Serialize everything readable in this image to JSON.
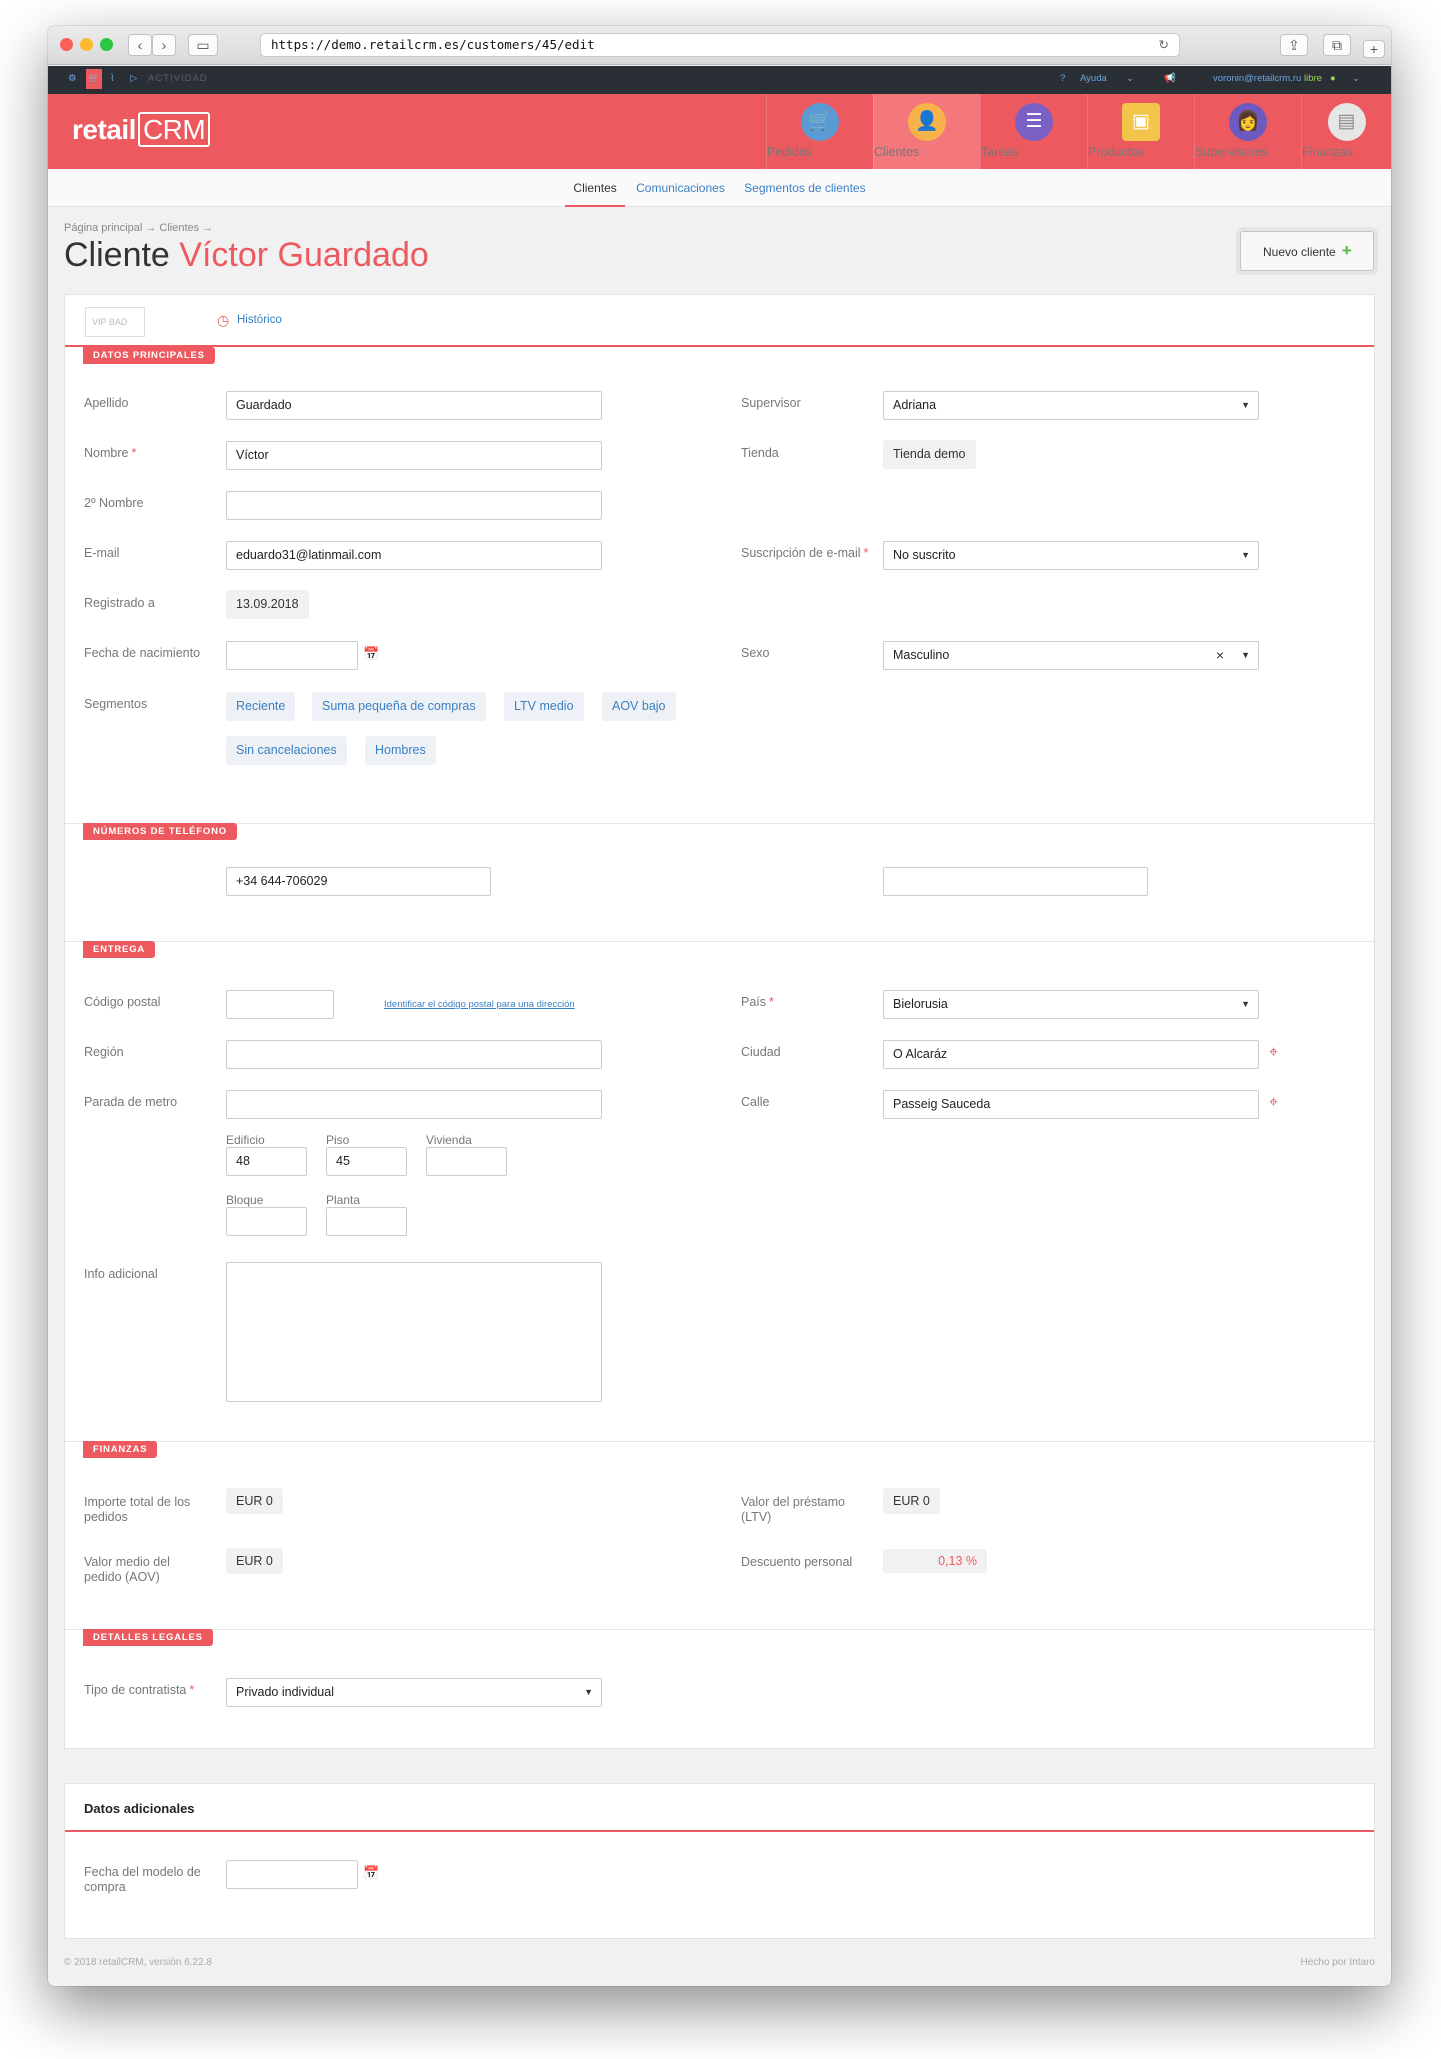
{
  "browser": {
    "url": "https://demo.retailcrm.es/customers/45/edit"
  },
  "topbar": {
    "activity": "ACTIVIDAD",
    "help": "Ayuda",
    "user": "voronin@retailcrm.ru",
    "status": "libre"
  },
  "brand": {
    "logo_left": "retail",
    "logo_right": "CRM"
  },
  "nav": [
    {
      "label": "Pedidos",
      "icon": "cart-icon"
    },
    {
      "label": "Clientes",
      "icon": "customer-icon"
    },
    {
      "label": "Tareas",
      "icon": "tasks-icon"
    },
    {
      "label": "Productos",
      "icon": "box-icon"
    },
    {
      "label": "Supervisores",
      "icon": "manager-icon"
    },
    {
      "label": "Finanzas",
      "icon": "finance-icon"
    }
  ],
  "subnav": [
    "Clientes",
    "Comunicaciones",
    "Segmentos de clientes"
  ],
  "breadcrumb": "Página principal → Clientes →",
  "page": {
    "title_prefix": "Cliente",
    "customer_name": "Víctor Guardado",
    "new_button": "Nuevo cliente"
  },
  "markers": {
    "vip": "VIP",
    "bad": "BAD",
    "history": "Histórico"
  },
  "main": {
    "section": "DATOS PRINCIPALES",
    "apellido_label": "Apellido",
    "apellido": "Guardado",
    "nombre_label": "Nombre",
    "nombre": "Víctor",
    "nombre2_label": "2º Nombre",
    "nombre2": "",
    "email_label": "E-mail",
    "email": "eduardo31@latinmail.com",
    "registered_label": "Registrado a",
    "registered": "13.09.2018",
    "birth_label": "Fecha de nacimiento",
    "birth": "",
    "segments_label": "Segmentos",
    "segments": [
      "Reciente",
      "Suma pequeña de compras",
      "LTV medio",
      "AOV bajo",
      "Sin cancelaciones",
      "Hombres"
    ],
    "supervisor_label": "Supervisor",
    "supervisor": "Adriana",
    "store_label": "Tienda",
    "store": "Tienda demo",
    "subscription_label": "Suscripción de e-mail",
    "subscription": "No suscrito",
    "sex_label": "Sexo",
    "sex": "Masculino"
  },
  "phones": {
    "section": "NÚMEROS DE TELÉFONO",
    "phone1": "+34 644-706029",
    "phone2": ""
  },
  "delivery": {
    "section": "ENTREGA",
    "zip_label": "Código postal",
    "zip": "",
    "zip_link": "Identificar el código postal para una dirección",
    "region_label": "Región",
    "region": "",
    "metro_label": "Parada de metro",
    "metro": "",
    "building_label": "Edificio",
    "building": "48",
    "floor_label": "Piso",
    "floor": "45",
    "flat_label": "Vivienda",
    "flat": "",
    "block_label": "Bloque",
    "block": "",
    "storey_label": "Planta",
    "storey": "",
    "info_label": "Info adicional",
    "info": "",
    "country_label": "País",
    "country": "Bielorusia",
    "city_label": "Ciudad",
    "city": "O Alcaráz",
    "street_label": "Calle",
    "street": "Passeig Sauceda"
  },
  "finance": {
    "section": "FINANZAS",
    "total_label": "Importe total de los pedidos",
    "total": "EUR 0",
    "aov_label": "Valor medio del pedido (AOV)",
    "aov": "EUR 0",
    "ltv_label": "Valor del préstamo (LTV)",
    "ltv": "EUR 0",
    "discount_label": "Descuento personal",
    "discount": "0,13 %"
  },
  "legal": {
    "section": "DETALLES LEGALES",
    "type_label": "Tipo de contratista",
    "type": "Privado individual"
  },
  "extra": {
    "title": "Datos adicionales",
    "model_date_label": "Fecha del modelo de compra",
    "model_date": ""
  },
  "footer": {
    "left": "© 2018 retailCRM, versión 6.22.8",
    "right": "Hecho por Intaro"
  },
  "colors": {
    "brand": "#ec5a60",
    "link": "#3b7fc4",
    "topbar": "#2a2f35"
  }
}
